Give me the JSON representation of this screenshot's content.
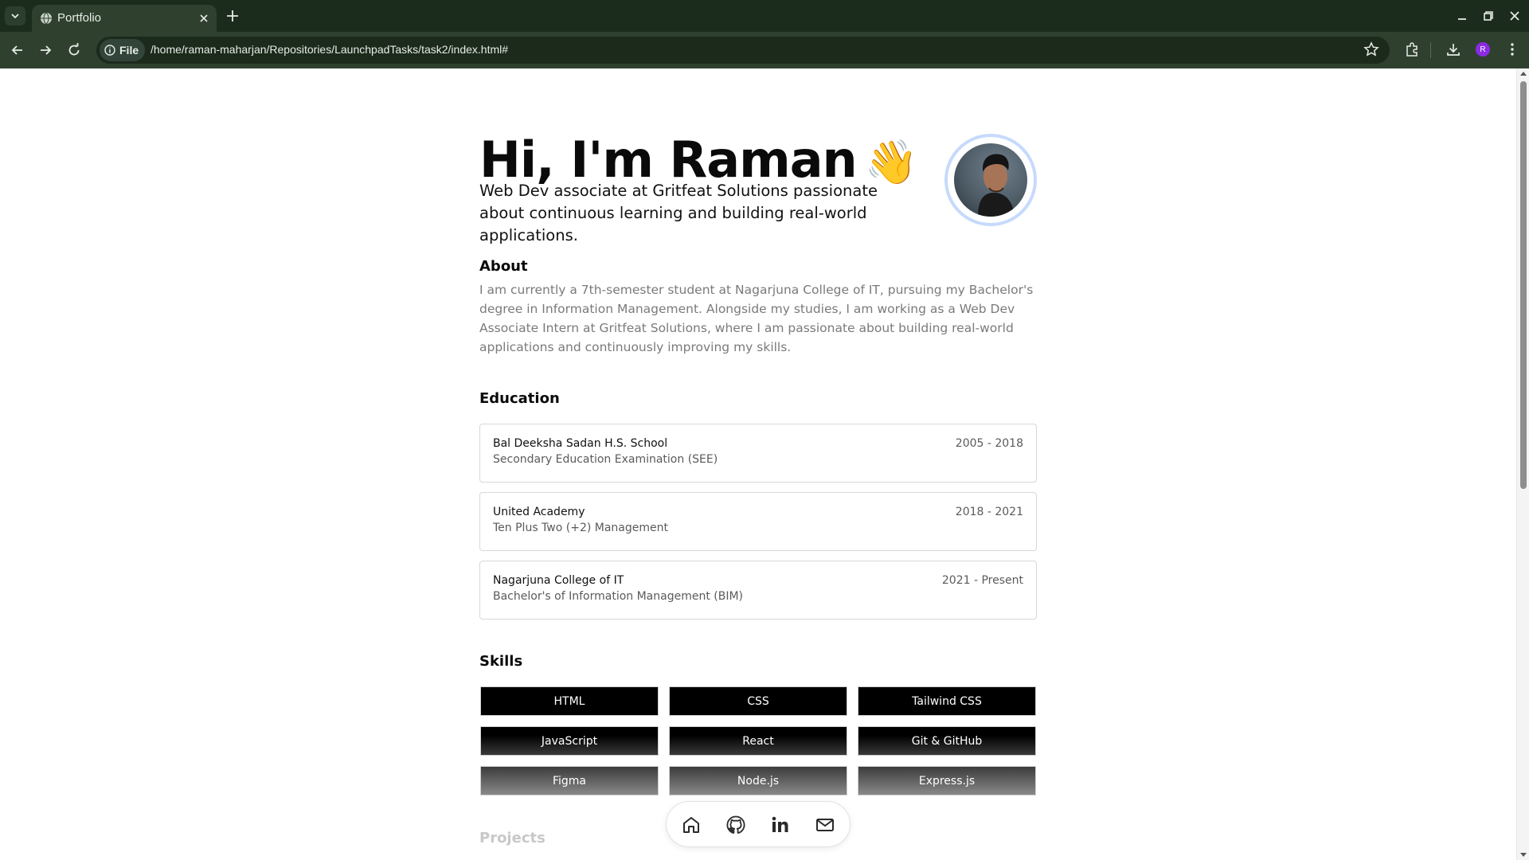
{
  "browser": {
    "tab_title": "Portfolio",
    "file_chip_label": "File",
    "url": "/home/raman-maharjan/Repositories/LaunchpadTasks/task2/index.html#",
    "profile_initial": "R"
  },
  "hero": {
    "greeting": "Hi, I'm Raman",
    "emoji": "👋",
    "subtitle": "Web Dev associate at Gritfeat Solutions passionate about continuous learning and building real-world applications."
  },
  "about": {
    "title": "About",
    "text": "I am currently a 7th-semester student at Nagarjuna College of IT, pursuing my Bachelor's degree in Information Management. Alongside my studies, I am working as a Web Dev Associate Intern at Gritfeat Solutions, where I am passionate about building real-world applications and continuously improving my skills."
  },
  "education": {
    "title": "Education",
    "items": [
      {
        "school": "Bal Deeksha Sadan H.S. School",
        "degree": "Secondary Education Examination (SEE)",
        "years": "2005 - 2018"
      },
      {
        "school": "United Academy",
        "degree": "Ten Plus Two (+2) Management",
        "years": "2018 - 2021"
      },
      {
        "school": "Nagarjuna College of IT",
        "degree": "Bachelor's of Information Management (BIM)",
        "years": "2021 - Present"
      }
    ]
  },
  "skills": {
    "title": "Skills",
    "items": [
      "HTML",
      "CSS",
      "Tailwind CSS",
      "JavaScript",
      "React",
      "Git & GitHub",
      "Figma",
      "Node.js",
      "Express.js"
    ]
  },
  "projects": {
    "title": "Projects"
  },
  "dock": {
    "icons": [
      "home-icon",
      "github-icon",
      "linkedin-icon",
      "mail-icon"
    ]
  }
}
